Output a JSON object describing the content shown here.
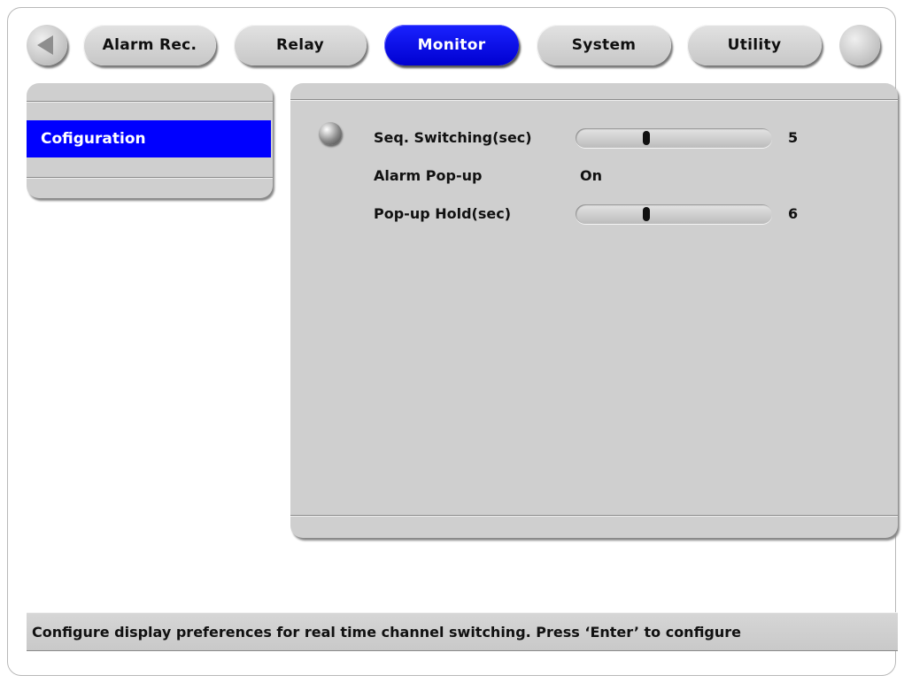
{
  "nav": {
    "back_icon": "left-arrow-icon",
    "tabs": [
      {
        "label": "Alarm Rec.",
        "active": false
      },
      {
        "label": "Relay",
        "active": false
      },
      {
        "label": "Monitor",
        "active": true
      },
      {
        "label": "System",
        "active": false
      },
      {
        "label": "Utility",
        "active": false
      }
    ]
  },
  "sidebar": {
    "items": [
      {
        "label": "Cofiguration",
        "selected": true
      }
    ]
  },
  "settings": {
    "seq_switching": {
      "label": "Seq. Switching(sec)",
      "value": "5",
      "slider_fraction": 0.36
    },
    "alarm_popup": {
      "label": "Alarm Pop-up",
      "value": "On"
    },
    "popup_hold": {
      "label": "Pop-up Hold(sec)",
      "value": "6",
      "slider_fraction": 0.36
    }
  },
  "status": {
    "message": "Configure display preferences for real time channel switching. Press ‘Enter’ to configure"
  },
  "colors": {
    "accent": "#0000ff",
    "panel": "#cfcfcf",
    "tab": "#d3d3d3",
    "background": "#ffffff"
  }
}
